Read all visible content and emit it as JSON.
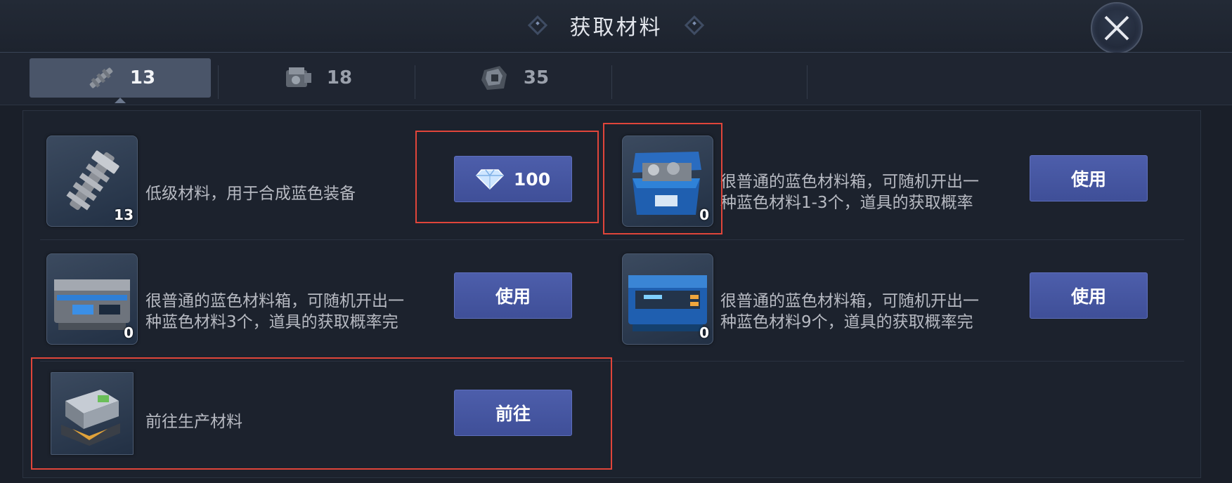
{
  "header": {
    "title": "获取材料"
  },
  "tabs": [
    {
      "count": "13",
      "active": true,
      "icon": "scope-part-icon"
    },
    {
      "count": "18",
      "active": false,
      "icon": "engine-part-icon"
    },
    {
      "count": "35",
      "active": false,
      "icon": "armor-part-icon"
    }
  ],
  "rows": {
    "r1_left": {
      "desc": "低级材料，用于合成蓝色装备",
      "count": "13",
      "button": "100",
      "button_icon": "diamond-icon"
    },
    "r1_right": {
      "desc_line1": "很普通的蓝色材料箱，可随机开出一",
      "desc_line2": "种蓝色材料1-3个，道具的获取概率",
      "count": "0",
      "button": "使用"
    },
    "r2_left": {
      "desc_line1": "很普通的蓝色材料箱，可随机开出一",
      "desc_line2": "种蓝色材料3个，道具的获取概率完",
      "count": "0",
      "button": "使用"
    },
    "r2_right": {
      "desc_line1": "很普通的蓝色材料箱，可随机开出一",
      "desc_line2": "种蓝色材料9个，道具的获取概率完",
      "count": "0",
      "button": "使用"
    },
    "r3_left": {
      "desc": "前往生产材料",
      "button": "前往"
    }
  },
  "colors": {
    "button": "#4656a2",
    "highlight": "#e0453a",
    "accent_blue": "#2f7fd6"
  }
}
